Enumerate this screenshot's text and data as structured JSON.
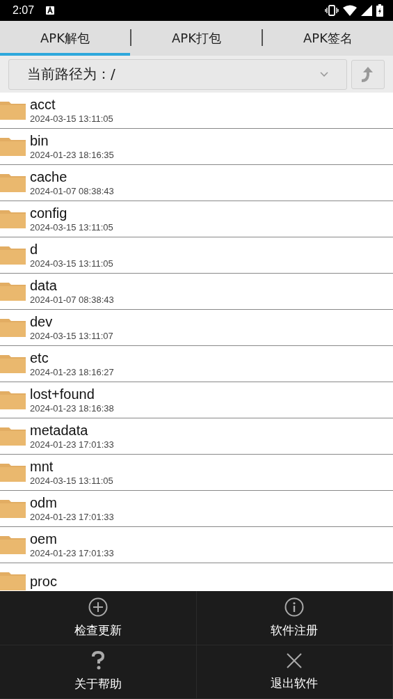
{
  "status_bar": {
    "time": "2:07"
  },
  "tabs": [
    {
      "label": "APK解包",
      "selected": true
    },
    {
      "label": "APK打包",
      "selected": false
    },
    {
      "label": "APK签名",
      "selected": false
    }
  ],
  "path": {
    "label": "当前路径为：/"
  },
  "files": [
    {
      "name": "acct",
      "date": "2024-03-15 13:11:05"
    },
    {
      "name": "bin",
      "date": "2024-01-23 18:16:35"
    },
    {
      "name": "cache",
      "date": "2024-01-07 08:38:43"
    },
    {
      "name": "config",
      "date": "2024-03-15 13:11:05"
    },
    {
      "name": "d",
      "date": "2024-03-15 13:11:05"
    },
    {
      "name": "data",
      "date": "2024-01-07 08:38:43"
    },
    {
      "name": "dev",
      "date": "2024-03-15 13:11:07"
    },
    {
      "name": "etc",
      "date": "2024-01-23 18:16:27"
    },
    {
      "name": "lost+found",
      "date": "2024-01-23 18:16:38"
    },
    {
      "name": "metadata",
      "date": "2024-01-23 17:01:33"
    },
    {
      "name": "mnt",
      "date": "2024-03-15 13:11:05"
    },
    {
      "name": "odm",
      "date": "2024-01-23 17:01:33"
    },
    {
      "name": "oem",
      "date": "2024-01-23 17:01:33"
    },
    {
      "name": "proc"
    }
  ],
  "menu": [
    {
      "label": "检查更新",
      "kind": "plus"
    },
    {
      "label": "软件注册",
      "kind": "info"
    },
    {
      "label": "关于帮助",
      "kind": "question"
    },
    {
      "label": "退出软件",
      "kind": "close"
    }
  ]
}
